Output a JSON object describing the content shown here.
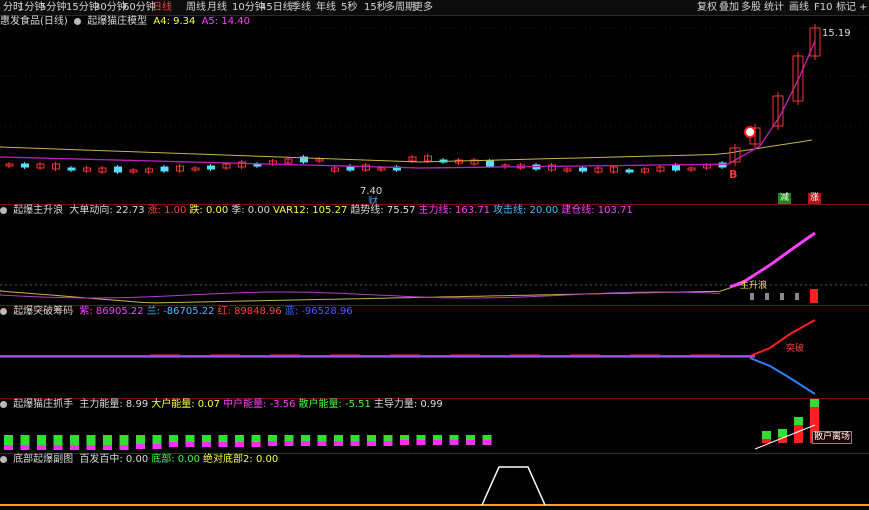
{
  "toolbar": {
    "left": [
      {
        "label": "分时",
        "active": false
      },
      {
        "label": "1分钟",
        "active": false
      },
      {
        "label": "5分钟",
        "active": false
      },
      {
        "label": "15分钟",
        "active": false
      },
      {
        "label": "30分钟",
        "active": false
      },
      {
        "label": "60分钟",
        "active": false
      },
      {
        "label": "日线",
        "active": true
      },
      {
        "label": "周线",
        "active": false
      },
      {
        "label": "月线",
        "active": false
      },
      {
        "label": "10分钟",
        "active": false
      },
      {
        "label": "45日线",
        "active": false
      },
      {
        "label": "季线",
        "active": false
      },
      {
        "label": "年线",
        "active": false
      },
      {
        "label": "5秒",
        "active": false
      },
      {
        "label": "15秒",
        "active": false
      },
      {
        "label": "多周期",
        "active": false
      },
      {
        "label": "更多",
        "active": false
      }
    ],
    "right": [
      {
        "label": "复权"
      },
      {
        "label": "叠加"
      },
      {
        "label": "多股"
      },
      {
        "label": "统计"
      },
      {
        "label": "画线"
      },
      {
        "label": "F10"
      },
      {
        "label": "标记"
      },
      {
        "label": "+自"
      }
    ]
  },
  "main_header": {
    "stock": "惠发食品(日线)",
    "indicator": "起爆猫庄模型",
    "a4_label": "A4:",
    "a4_value": "9.34",
    "a5_label": "A5:",
    "a5_value": "14.40"
  },
  "main_chart": {
    "high_label": "15.19",
    "low_label": "7.40",
    "marker_b": "B",
    "marker_cai": "财",
    "tag_left": "减",
    "tag_right": "涨",
    "colors": {
      "up": "#ff3333",
      "down": "#54e0ff",
      "ma_yellow": "#c8b44a",
      "ma_purple": "#c020c0",
      "magenta": "#ff40ff"
    }
  },
  "panel2": {
    "name": "起爆主升浪",
    "items": [
      {
        "label": "大单动向:",
        "value": "22.73",
        "color": "#dcdcdc"
      },
      {
        "label": "涨:",
        "value": "1.00",
        "color": "#ff4040"
      },
      {
        "label": "跌:",
        "value": "0.00",
        "color": "#ffff40"
      },
      {
        "label": "季:",
        "value": "0.00",
        "color": "#dcdcdc"
      },
      {
        "label": "VAR12:",
        "value": "105.27",
        "color": "#ffff40"
      },
      {
        "label": "趋势线:",
        "value": "75.57",
        "color": "#dcdcdc"
      },
      {
        "label": "主力线:",
        "value": "163.71",
        "color": "#ff40ff"
      },
      {
        "label": "攻击线:",
        "value": "20.00",
        "color": "#40c0ff"
      },
      {
        "label": "建仓线:",
        "value": "103.71",
        "color": "#ff40ff"
      }
    ],
    "flag_label": "主升浪"
  },
  "panel3": {
    "name": "起爆突破筹码",
    "items": [
      {
        "label": "紫:",
        "value": "86905.22",
        "color": "#ff40ff"
      },
      {
        "label": "兰:",
        "value": "-86705.22",
        "color": "#40c0ff"
      },
      {
        "label": "红:",
        "value": "89848.96",
        "color": "#ff4040"
      },
      {
        "label": "蓝:",
        "value": "-96528.96",
        "color": "#4060ff"
      }
    ],
    "breakout_label": "突破"
  },
  "panel4": {
    "name": "起爆猫庄抓手",
    "items": [
      {
        "label": "主力能量:",
        "value": "8.99",
        "color": "#dcdcdc"
      },
      {
        "label": "大户能量:",
        "value": "0.07",
        "color": "#ffff40"
      },
      {
        "label": "中户能量:",
        "value": "-3.56",
        "color": "#ff40ff"
      },
      {
        "label": "散户能量:",
        "value": "-5.51",
        "color": "#40ff40"
      },
      {
        "label": "主导力量:",
        "value": "0.99",
        "color": "#dcdcdc"
      }
    ],
    "banner": "散户离场"
  },
  "panel5": {
    "name": "底部起爆副图",
    "items": [
      {
        "label": "百发百中:",
        "value": "0.00",
        "color": "#dcdcdc"
      },
      {
        "label": "底部:",
        "value": "0.00",
        "color": "#40ff40"
      },
      {
        "label": "绝对底部2:",
        "value": "0.00",
        "color": "#ffff40"
      }
    ]
  }
}
